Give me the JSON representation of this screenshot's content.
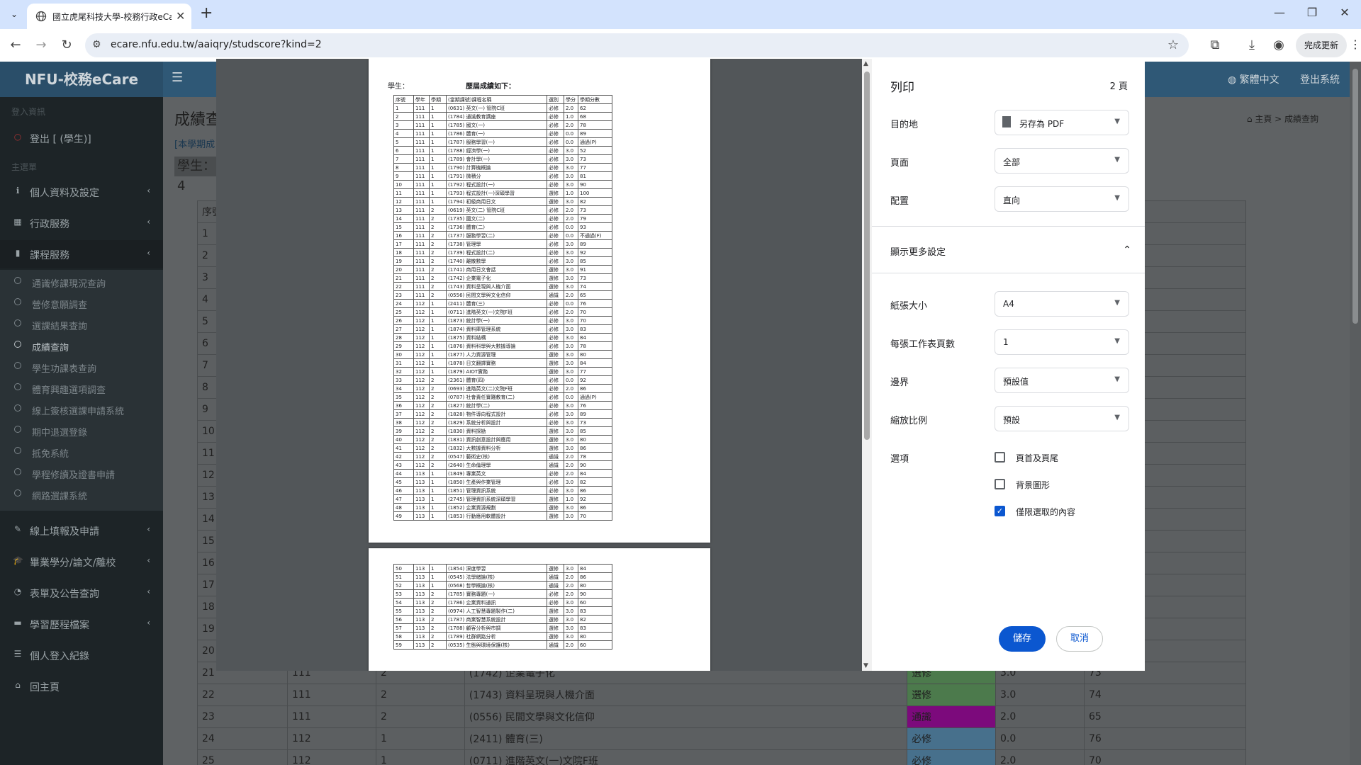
{
  "browser": {
    "tab_title": "國立虎尾科技大學-校務行政eCare",
    "url": "ecare.nfu.edu.tw/aaiqry/studscore?kind=2",
    "update_label": "完成更新"
  },
  "app": {
    "logo": "NFU-校務eCare",
    "lang_link": "繁體中文",
    "logout_link": "登出系統",
    "page_title": "成績查",
    "page_note": "[本學期成",
    "student_label": "學生：4",
    "breadcrumb": "主頁 > 成績查詢"
  },
  "sidebar": {
    "heading_login": "登入資訊",
    "logout_item": "登出 [        (學生)]",
    "heading_main": "主選單",
    "items": [
      {
        "label": "個人資料及設定"
      },
      {
        "label": "行政服務"
      },
      {
        "label": "課程服務"
      }
    ],
    "sub_items": [
      "通識修課現況查詢",
      "營修意願調查",
      "選課結果查詢",
      "成績查詢",
      "學生功課表查詢",
      "體育興趣選項調查",
      "線上簽核選課申請系統",
      "期中退選登錄",
      "抵免系統",
      "學程修讀及證書申請",
      "網路選課系統"
    ],
    "more_items": [
      {
        "label": "線上填報及申請"
      },
      {
        "label": "畢業學分/論文/離校"
      },
      {
        "label": "表單及公告查詢"
      },
      {
        "label": "學習歷程檔案"
      },
      {
        "label": "個人登入紀錄"
      },
      {
        "label": "回主頁"
      }
    ]
  },
  "bg_table": {
    "index_rows": [
      "序號",
      "1",
      "2",
      "3",
      "4",
      "5",
      "6",
      "7",
      "8",
      "9",
      "10",
      "11",
      "12",
      "13",
      "14",
      "15",
      "16",
      "17",
      "18",
      "19",
      "20"
    ],
    "full_rows": [
      {
        "n": "21",
        "y": "111",
        "s": "2",
        "c": "(1742) 企業電子化",
        "t": "選修",
        "cr": "3.0",
        "g": "73"
      },
      {
        "n": "22",
        "y": "111",
        "s": "2",
        "c": "(1743) 資料呈現與人機介面",
        "t": "選修",
        "cr": "3.0",
        "g": "74"
      },
      {
        "n": "23",
        "y": "111",
        "s": "2",
        "c": "(0556) 民間文學與文化信仰",
        "t": "通識",
        "cr": "2.0",
        "g": "65"
      },
      {
        "n": "24",
        "y": "112",
        "s": "1",
        "c": "(2411) 體育(三)",
        "t": "必修",
        "cr": "0.0",
        "g": "76"
      },
      {
        "n": "25",
        "y": "112",
        "s": "1",
        "c": "(0711) 進階英文(一)文院F班",
        "t": "必修",
        "cr": "2.0",
        "g": "70"
      }
    ]
  },
  "print_preview": {
    "page1_student": "學生：",
    "page1_heading": "歷屆成績如下：",
    "headers": [
      "序號",
      "學年",
      "學期",
      "(當期課號)課程名稱",
      "選別",
      "學分",
      "學期分數"
    ],
    "rows_page1": [
      [
        "1",
        "111",
        "1",
        "(0631) 英文(一) 管院C班",
        "必修",
        "2.0",
        "62"
      ],
      [
        "2",
        "111",
        "1",
        "(1784) 通識教育講座",
        "必修",
        "1.0",
        "68"
      ],
      [
        "3",
        "111",
        "1",
        "(1785) 國文(一)",
        "必修",
        "2.0",
        "78"
      ],
      [
        "4",
        "111",
        "1",
        "(1786) 體育(一)",
        "必修",
        "0.0",
        "89"
      ],
      [
        "5",
        "111",
        "1",
        "(1787) 服務學習(一)",
        "必修",
        "0.0",
        "通過(P)"
      ],
      [
        "6",
        "111",
        "1",
        "(1788) 經濟學(一)",
        "必修",
        "3.0",
        "52"
      ],
      [
        "7",
        "111",
        "1",
        "(1789) 會計學(一)",
        "必修",
        "3.0",
        "73"
      ],
      [
        "8",
        "111",
        "1",
        "(1790) 計算機概論",
        "必修",
        "3.0",
        "77"
      ],
      [
        "9",
        "111",
        "1",
        "(1791) 微積分",
        "必修",
        "3.0",
        "81"
      ],
      [
        "10",
        "111",
        "1",
        "(1792) 程式設計(一)",
        "必修",
        "3.0",
        "90"
      ],
      [
        "11",
        "111",
        "1",
        "(1793) 程式設計(一)深碩學習",
        "選修",
        "1.0",
        "100"
      ],
      [
        "12",
        "111",
        "1",
        "(1794) 初級商用日文",
        "選修",
        "3.0",
        "82"
      ],
      [
        "13",
        "111",
        "2",
        "(0619) 英文(二) 管院C班",
        "必修",
        "2.0",
        "73"
      ],
      [
        "14",
        "111",
        "2",
        "(1735) 國文(二)",
        "必修",
        "2.0",
        "79"
      ],
      [
        "15",
        "111",
        "2",
        "(1736) 體育(二)",
        "必修",
        "0.0",
        "93"
      ],
      [
        "16",
        "111",
        "2",
        "(1737) 服務學習(二)",
        "必修",
        "0.0",
        "不通過(F)"
      ],
      [
        "17",
        "111",
        "2",
        "(1738) 管理學",
        "必修",
        "3.0",
        "89"
      ],
      [
        "18",
        "111",
        "2",
        "(1739) 程式設計(二)",
        "必修",
        "3.0",
        "92"
      ],
      [
        "19",
        "111",
        "2",
        "(1740) 離散數學",
        "必修",
        "3.0",
        "85"
      ],
      [
        "20",
        "111",
        "2",
        "(1741) 商用日文會話",
        "選修",
        "3.0",
        "91"
      ],
      [
        "21",
        "111",
        "2",
        "(1742) 企業電子化",
        "選修",
        "3.0",
        "73"
      ],
      [
        "22",
        "111",
        "2",
        "(1743) 資料呈現與人機介面",
        "選修",
        "3.0",
        "74"
      ],
      [
        "23",
        "111",
        "2",
        "(0556) 民間文學與文化信仰",
        "通識",
        "2.0",
        "65"
      ],
      [
        "24",
        "112",
        "1",
        "(2411) 體育(三)",
        "必修",
        "0.0",
        "76"
      ],
      [
        "25",
        "112",
        "1",
        "(0711) 進階英文(一)文院F班",
        "必修",
        "2.0",
        "70"
      ],
      [
        "26",
        "112",
        "1",
        "(1873) 統計學(一)",
        "必修",
        "3.0",
        "70"
      ],
      [
        "27",
        "112",
        "1",
        "(1874) 資料庫管理系統",
        "必修",
        "3.0",
        "83"
      ],
      [
        "28",
        "112",
        "1",
        "(1875) 資料結構",
        "必修",
        "3.0",
        "84"
      ],
      [
        "29",
        "112",
        "1",
        "(1876) 資料科學與大數據導論",
        "必修",
        "3.0",
        "78"
      ],
      [
        "30",
        "112",
        "1",
        "(1877) 人力資源管理",
        "選修",
        "3.0",
        "80"
      ],
      [
        "31",
        "112",
        "1",
        "(1878) 日文翻譯實務",
        "選修",
        "3.0",
        "84"
      ],
      [
        "32",
        "112",
        "1",
        "(1879) AIOT實務",
        "選修",
        "3.0",
        "77"
      ],
      [
        "33",
        "112",
        "2",
        "(2361) 體育(四)",
        "必修",
        "0.0",
        "92"
      ],
      [
        "34",
        "112",
        "2",
        "(0693) 進階英文(二)文院F班",
        "必修",
        "2.0",
        "86"
      ],
      [
        "35",
        "112",
        "2",
        "(0787) 社會責任實踐教育(二)",
        "必修",
        "0.0",
        "通過(P)"
      ],
      [
        "36",
        "112",
        "2",
        "(1827) 統計學(二)",
        "必修",
        "3.0",
        "76"
      ],
      [
        "37",
        "112",
        "2",
        "(1828) 物件導向程式設計",
        "必修",
        "3.0",
        "89"
      ],
      [
        "38",
        "112",
        "2",
        "(1829) 系統分析與設計",
        "必修",
        "3.0",
        "73"
      ],
      [
        "39",
        "112",
        "2",
        "(1830) 資料探勘",
        "選修",
        "3.0",
        "85"
      ],
      [
        "40",
        "112",
        "2",
        "(1831) 資訊創意設計與應用",
        "選修",
        "3.0",
        "80"
      ],
      [
        "41",
        "112",
        "2",
        "(1832) 大數據資料分析",
        "選修",
        "3.0",
        "86"
      ],
      [
        "42",
        "112",
        "2",
        "(0547) 藝術史(核)",
        "通識",
        "2.0",
        "78"
      ],
      [
        "43",
        "112",
        "2",
        "(2640) 生命倫理學",
        "通識",
        "2.0",
        "90"
      ],
      [
        "44",
        "113",
        "1",
        "(1849) 專業英文",
        "必修",
        "2.0",
        "84"
      ],
      [
        "45",
        "113",
        "1",
        "(1850) 生產與作業管理",
        "必修",
        "3.0",
        "82"
      ],
      [
        "46",
        "113",
        "1",
        "(1851) 管理資訊系統",
        "必修",
        "3.0",
        "86"
      ],
      [
        "47",
        "113",
        "1",
        "(2745) 管理資訊系統深碩學習",
        "選修",
        "1.0",
        "92"
      ],
      [
        "48",
        "113",
        "1",
        "(1852) 企業資源規劃",
        "選修",
        "3.0",
        "86"
      ],
      [
        "49",
        "113",
        "1",
        "(1853) 行動應用軟體設計",
        "選修",
        "3.0",
        "70"
      ]
    ],
    "rows_page2": [
      [
        "50",
        "113",
        "1",
        "(1854) 深度學習",
        "選修",
        "3.0",
        "84"
      ],
      [
        "51",
        "113",
        "1",
        "(0545) 法學緒論(核)",
        "通識",
        "2.0",
        "86"
      ],
      [
        "52",
        "113",
        "1",
        "(0568) 哲學概論(核)",
        "通識",
        "2.0",
        "80"
      ],
      [
        "53",
        "113",
        "2",
        "(1785) 實務專題(一)",
        "必修",
        "2.0",
        "90"
      ],
      [
        "54",
        "113",
        "2",
        "(1786) 企業資料通訊",
        "必修",
        "3.0",
        "60"
      ],
      [
        "55",
        "113",
        "2",
        "(0974) 人工智慧專題製作(二)",
        "選修",
        "3.0",
        "83"
      ],
      [
        "56",
        "113",
        "2",
        "(1787) 商業智慧系統設計",
        "選修",
        "3.0",
        "82"
      ],
      [
        "57",
        "113",
        "2",
        "(1788) 顧客分析與市調",
        "選修",
        "3.0",
        "83"
      ],
      [
        "58",
        "113",
        "2",
        "(1789) 社群網路分析",
        "選修",
        "3.0",
        "80"
      ],
      [
        "59",
        "113",
        "2",
        "(0535) 生態與環境保護(核)",
        "通識",
        "2.0",
        "60"
      ]
    ]
  },
  "print_settings": {
    "title": "列印",
    "pages_count": "2 頁",
    "destination_label": "目的地",
    "destination_value": "另存為 PDF",
    "pages_label": "頁面",
    "pages_value": "全部",
    "layout_label": "配置",
    "layout_value": "直向",
    "more_settings": "顯示更多設定",
    "paper_label": "紙張大小",
    "paper_value": "A4",
    "pps_label": "每張工作表頁數",
    "pps_value": "1",
    "margins_label": "邊界",
    "margins_value": "預設值",
    "scale_label": "縮放比例",
    "scale_value": "預設",
    "options_label": "選項",
    "opt_headers": "頁首及頁尾",
    "opt_headers_checked": false,
    "opt_bg": "背景圖形",
    "opt_bg_checked": false,
    "opt_selection": "僅限選取的內容",
    "opt_selection_checked": true,
    "save_label": "儲存",
    "cancel_label": "取消"
  }
}
